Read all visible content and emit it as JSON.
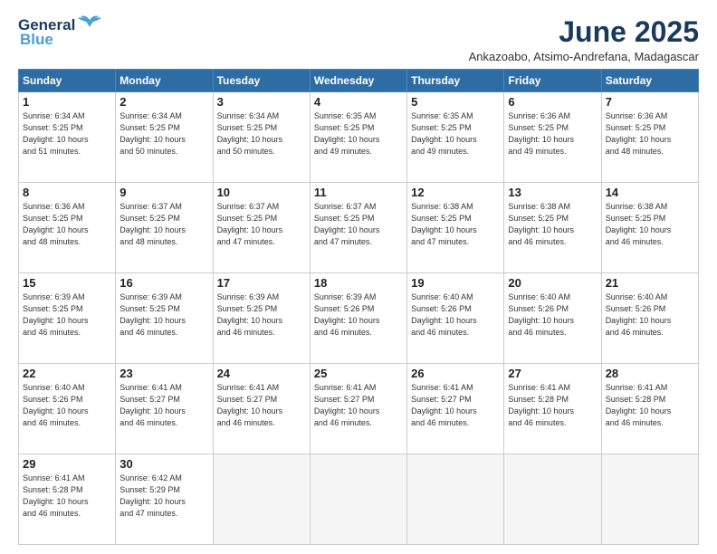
{
  "logo": {
    "line1": "General",
    "line2": "Blue",
    "bird": "🐦"
  },
  "title": "June 2025",
  "subtitle": "Ankazoabo, Atsimo-Andrefana, Madagascar",
  "days_header": [
    "Sunday",
    "Monday",
    "Tuesday",
    "Wednesday",
    "Thursday",
    "Friday",
    "Saturday"
  ],
  "weeks": [
    [
      {
        "day": "1",
        "info": "Sunrise: 6:34 AM\nSunset: 5:25 PM\nDaylight: 10 hours\nand 51 minutes."
      },
      {
        "day": "2",
        "info": "Sunrise: 6:34 AM\nSunset: 5:25 PM\nDaylight: 10 hours\nand 50 minutes."
      },
      {
        "day": "3",
        "info": "Sunrise: 6:34 AM\nSunset: 5:25 PM\nDaylight: 10 hours\nand 50 minutes."
      },
      {
        "day": "4",
        "info": "Sunrise: 6:35 AM\nSunset: 5:25 PM\nDaylight: 10 hours\nand 49 minutes."
      },
      {
        "day": "5",
        "info": "Sunrise: 6:35 AM\nSunset: 5:25 PM\nDaylight: 10 hours\nand 49 minutes."
      },
      {
        "day": "6",
        "info": "Sunrise: 6:36 AM\nSunset: 5:25 PM\nDaylight: 10 hours\nand 49 minutes."
      },
      {
        "day": "7",
        "info": "Sunrise: 6:36 AM\nSunset: 5:25 PM\nDaylight: 10 hours\nand 48 minutes."
      }
    ],
    [
      {
        "day": "8",
        "info": "Sunrise: 6:36 AM\nSunset: 5:25 PM\nDaylight: 10 hours\nand 48 minutes."
      },
      {
        "day": "9",
        "info": "Sunrise: 6:37 AM\nSunset: 5:25 PM\nDaylight: 10 hours\nand 48 minutes."
      },
      {
        "day": "10",
        "info": "Sunrise: 6:37 AM\nSunset: 5:25 PM\nDaylight: 10 hours\nand 47 minutes."
      },
      {
        "day": "11",
        "info": "Sunrise: 6:37 AM\nSunset: 5:25 PM\nDaylight: 10 hours\nand 47 minutes."
      },
      {
        "day": "12",
        "info": "Sunrise: 6:38 AM\nSunset: 5:25 PM\nDaylight: 10 hours\nand 47 minutes."
      },
      {
        "day": "13",
        "info": "Sunrise: 6:38 AM\nSunset: 5:25 PM\nDaylight: 10 hours\nand 46 minutes."
      },
      {
        "day": "14",
        "info": "Sunrise: 6:38 AM\nSunset: 5:25 PM\nDaylight: 10 hours\nand 46 minutes."
      }
    ],
    [
      {
        "day": "15",
        "info": "Sunrise: 6:39 AM\nSunset: 5:25 PM\nDaylight: 10 hours\nand 46 minutes."
      },
      {
        "day": "16",
        "info": "Sunrise: 6:39 AM\nSunset: 5:25 PM\nDaylight: 10 hours\nand 46 minutes."
      },
      {
        "day": "17",
        "info": "Sunrise: 6:39 AM\nSunset: 5:25 PM\nDaylight: 10 hours\nand 46 minutes."
      },
      {
        "day": "18",
        "info": "Sunrise: 6:39 AM\nSunset: 5:26 PM\nDaylight: 10 hours\nand 46 minutes."
      },
      {
        "day": "19",
        "info": "Sunrise: 6:40 AM\nSunset: 5:26 PM\nDaylight: 10 hours\nand 46 minutes."
      },
      {
        "day": "20",
        "info": "Sunrise: 6:40 AM\nSunset: 5:26 PM\nDaylight: 10 hours\nand 46 minutes."
      },
      {
        "day": "21",
        "info": "Sunrise: 6:40 AM\nSunset: 5:26 PM\nDaylight: 10 hours\nand 46 minutes."
      }
    ],
    [
      {
        "day": "22",
        "info": "Sunrise: 6:40 AM\nSunset: 5:26 PM\nDaylight: 10 hours\nand 46 minutes."
      },
      {
        "day": "23",
        "info": "Sunrise: 6:41 AM\nSunset: 5:27 PM\nDaylight: 10 hours\nand 46 minutes."
      },
      {
        "day": "24",
        "info": "Sunrise: 6:41 AM\nSunset: 5:27 PM\nDaylight: 10 hours\nand 46 minutes."
      },
      {
        "day": "25",
        "info": "Sunrise: 6:41 AM\nSunset: 5:27 PM\nDaylight: 10 hours\nand 46 minutes."
      },
      {
        "day": "26",
        "info": "Sunrise: 6:41 AM\nSunset: 5:27 PM\nDaylight: 10 hours\nand 46 minutes."
      },
      {
        "day": "27",
        "info": "Sunrise: 6:41 AM\nSunset: 5:28 PM\nDaylight: 10 hours\nand 46 minutes."
      },
      {
        "day": "28",
        "info": "Sunrise: 6:41 AM\nSunset: 5:28 PM\nDaylight: 10 hours\nand 46 minutes."
      }
    ],
    [
      {
        "day": "29",
        "info": "Sunrise: 6:41 AM\nSunset: 5:28 PM\nDaylight: 10 hours\nand 46 minutes."
      },
      {
        "day": "30",
        "info": "Sunrise: 6:42 AM\nSunset: 5:29 PM\nDaylight: 10 hours\nand 47 minutes."
      },
      {
        "day": "",
        "info": ""
      },
      {
        "day": "",
        "info": ""
      },
      {
        "day": "",
        "info": ""
      },
      {
        "day": "",
        "info": ""
      },
      {
        "day": "",
        "info": ""
      }
    ]
  ]
}
